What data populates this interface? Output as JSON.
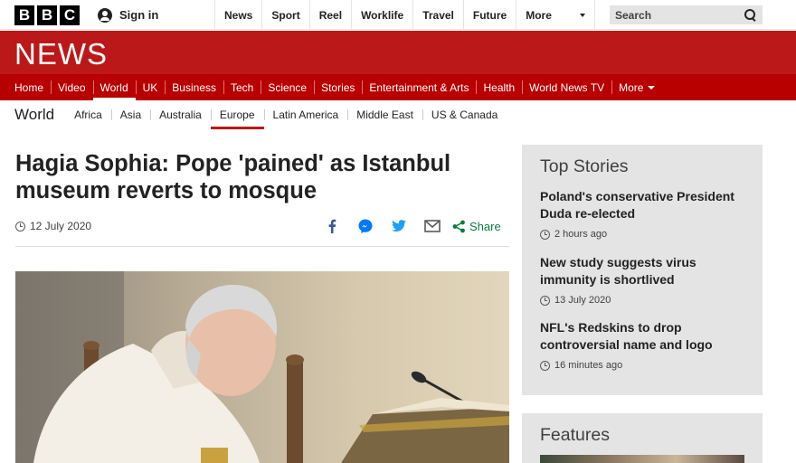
{
  "bbc": {
    "logo_letters": [
      "B",
      "B",
      "C"
    ],
    "signin_label": "Sign in",
    "nav": [
      "News",
      "Sport",
      "Reel",
      "Worklife",
      "Travel",
      "Future"
    ],
    "more_label": "More",
    "search_placeholder": "Search"
  },
  "news_logo": "NEWS",
  "section_nav": {
    "items": [
      "Home",
      "Video",
      "World",
      "UK",
      "Business",
      "Tech",
      "Science",
      "Stories",
      "Entertainment & Arts",
      "Health",
      "World News TV"
    ],
    "more_label": "More",
    "active": "World"
  },
  "world_nav": {
    "title": "World",
    "items": [
      "Africa",
      "Asia",
      "Australia",
      "Europe",
      "Latin America",
      "Middle East",
      "US & Canada"
    ],
    "active": "Europe"
  },
  "article": {
    "headline": "Hagia Sophia: Pope 'pained' as Istanbul museum reverts to mosque",
    "date": "12 July 2020",
    "share_label": "Share",
    "share_icons": [
      "facebook-icon",
      "messenger-icon",
      "twitter-icon",
      "email-icon",
      "share-icon"
    ]
  },
  "top_stories": {
    "title": "Top Stories",
    "items": [
      {
        "title": "Poland's conservative President Duda re-elected",
        "time": "2 hours ago"
      },
      {
        "title": "New study suggests virus immunity is shortlived",
        "time": "13 July 2020"
      },
      {
        "title": "NFL's Redskins to drop controversial name and logo",
        "time": "16 minutes ago"
      }
    ]
  },
  "features": {
    "title": "Features"
  },
  "colors": {
    "bbc_red": "#bb1919",
    "nav_red": "#b80000",
    "share_green": "#0b7c3d",
    "sidebar_grey": "#e4e4e4"
  }
}
